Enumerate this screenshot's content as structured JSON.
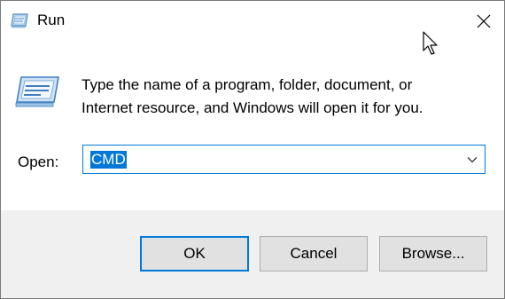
{
  "window": {
    "title": "Run"
  },
  "icons": {
    "title_icon": "run-dialog-icon",
    "big_icon": "run-dialog-icon",
    "close_icon": "close-icon",
    "dropdown_icon": "chevron-down-icon",
    "cursor": "mouse-pointer-icon"
  },
  "message": {
    "line1": "Type the name of a program, folder, document, or",
    "line2": "Internet resource, and Windows will open it for you."
  },
  "open": {
    "label": "Open:",
    "value": "CMD"
  },
  "buttons": {
    "ok": "OK",
    "cancel": "Cancel",
    "browse": "Browse..."
  },
  "colors": {
    "accent": "#0078d7",
    "footer": "#f0f0f0",
    "button_face": "#e1e1e1"
  }
}
